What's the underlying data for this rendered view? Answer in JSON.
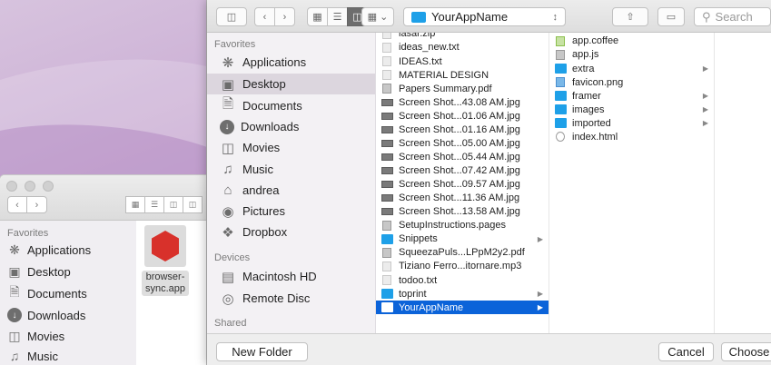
{
  "background_window": {
    "sidebar_title": "Favorites",
    "items": [
      {
        "label": "Applications",
        "icon": "applications-icon"
      },
      {
        "label": "Desktop",
        "icon": "desktop-icon"
      },
      {
        "label": "Documents",
        "icon": "documents-icon"
      },
      {
        "label": "Downloads",
        "icon": "downloads-icon"
      },
      {
        "label": "Movies",
        "icon": "movies-icon"
      },
      {
        "label": "Music",
        "icon": "music-icon"
      }
    ],
    "file": {
      "name_line1": "browser-",
      "name_line2": "sync.app"
    }
  },
  "toolbar": {
    "location": "YourAppName",
    "search_placeholder": "Search"
  },
  "sidebar": {
    "favorites_title": "Favorites",
    "favorites": [
      {
        "label": "Applications",
        "icon": "applications-icon"
      },
      {
        "label": "Desktop",
        "icon": "desktop-icon",
        "selected": true
      },
      {
        "label": "Documents",
        "icon": "documents-icon"
      },
      {
        "label": "Downloads",
        "icon": "downloads-icon"
      },
      {
        "label": "Movies",
        "icon": "movies-icon"
      },
      {
        "label": "Music",
        "icon": "music-icon"
      },
      {
        "label": "andrea",
        "icon": "home-icon"
      },
      {
        "label": "Pictures",
        "icon": "camera-icon"
      },
      {
        "label": "Dropbox",
        "icon": "dropbox-icon"
      }
    ],
    "devices_title": "Devices",
    "devices": [
      {
        "label": "Macintosh HD",
        "icon": "hard-drive-icon"
      },
      {
        "label": "Remote Disc",
        "icon": "disc-icon"
      }
    ],
    "shared_title": "Shared"
  },
  "column1": {
    "items": [
      {
        "label": "lasar.zip",
        "type": "doc"
      },
      {
        "label": "ideas_new.txt",
        "type": "doc"
      },
      {
        "label": "IDEAS.txt",
        "type": "doc"
      },
      {
        "label": "MATERIAL DESIGN",
        "type": "doc"
      },
      {
        "label": "Papers Summary.pdf",
        "type": "code"
      },
      {
        "label": "Screen Shot...43.08 AM.jpg",
        "type": "img"
      },
      {
        "label": "Screen Shot...01.06 AM.jpg",
        "type": "img"
      },
      {
        "label": "Screen Shot...01.16 AM.jpg",
        "type": "img"
      },
      {
        "label": "Screen Shot...05.00 AM.jpg",
        "type": "img"
      },
      {
        "label": "Screen Shot...05.44 AM.jpg",
        "type": "img"
      },
      {
        "label": "Screen Shot...07.42 AM.jpg",
        "type": "img"
      },
      {
        "label": "Screen Shot...09.57 AM.jpg",
        "type": "img"
      },
      {
        "label": "Screen Shot...11.36 AM.jpg",
        "type": "img"
      },
      {
        "label": "Screen Shot...13.58 AM.jpg",
        "type": "img"
      },
      {
        "label": "SetupInstructions.pages",
        "type": "code"
      },
      {
        "label": "Snippets",
        "type": "folder",
        "has_children": true
      },
      {
        "label": "SqueezaPuls...LPpM2y2.pdf",
        "type": "code"
      },
      {
        "label": "Tiziano Ferro...itornare.mp3",
        "type": "doc"
      },
      {
        "label": "todoo.txt",
        "type": "doc"
      },
      {
        "label": "toprint",
        "type": "folder",
        "has_children": true
      },
      {
        "label": "YourAppName",
        "type": "folder",
        "has_children": true,
        "selected": true
      }
    ]
  },
  "column2": {
    "items": [
      {
        "label": "app.coffee",
        "type": "coffee"
      },
      {
        "label": "app.js",
        "type": "code"
      },
      {
        "label": "extra",
        "type": "folder",
        "has_children": true
      },
      {
        "label": "favicon.png",
        "type": "png"
      },
      {
        "label": "framer",
        "type": "folder",
        "has_children": true
      },
      {
        "label": "images",
        "type": "folder",
        "has_children": true
      },
      {
        "label": "imported",
        "type": "folder",
        "has_children": true
      },
      {
        "label": "index.html",
        "type": "html"
      }
    ]
  },
  "footer": {
    "new_folder": "New Folder",
    "cancel": "Cancel",
    "choose": "Choose"
  },
  "colors": {
    "selection": "#0b63d9",
    "folder": "#1ea0e8",
    "sidebar_selected": "#dcd6de"
  }
}
